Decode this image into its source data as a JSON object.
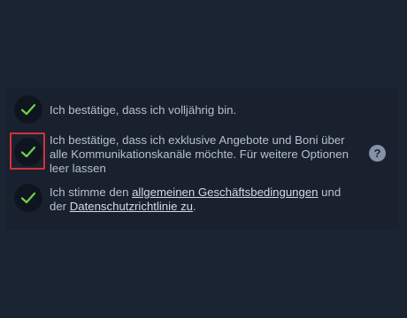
{
  "consent": {
    "items": [
      {
        "text": "Ich bestätige, dass ich volljährig bin.",
        "checked": true
      },
      {
        "text": "Ich bestätige, dass ich exklusive Angebote und Boni über alle Kommunikationskanäle möchte. Für weitere Optionen leer lassen",
        "checked": true,
        "highlighted": true
      },
      {
        "text_before": "Ich stimme den ",
        "link1": "allgemeinen Geschäftsbedingungen",
        "text_middle": " und der ",
        "link2": "Datenschutzrichtlinie zu",
        "text_after": ".",
        "checked": true
      }
    ],
    "help_symbol": "?"
  },
  "colors": {
    "background": "#1b2433",
    "panel": "#19212e",
    "check_circle": "#0f151e",
    "check_mark": "#6fd34a",
    "highlight_border": "#d6303a",
    "text": "#b6c0cf",
    "link": "#d3dae5",
    "help_icon": "#8592a7"
  },
  "icons": {
    "checkbox": "check-icon",
    "help": "question-mark-icon"
  }
}
